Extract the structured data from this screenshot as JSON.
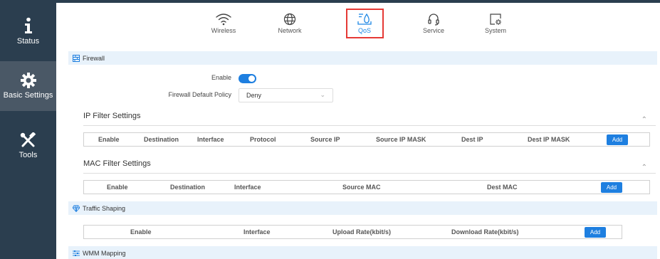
{
  "sidebar": {
    "items": [
      {
        "label": "Status"
      },
      {
        "label": "Basic Settings"
      },
      {
        "label": "Tools"
      }
    ]
  },
  "nav": {
    "items": [
      {
        "label": "Wireless"
      },
      {
        "label": "Network"
      },
      {
        "label": "QoS"
      },
      {
        "label": "Service"
      },
      {
        "label": "System"
      }
    ]
  },
  "firewall": {
    "title": "Firewall",
    "enable_label": "Enable",
    "default_policy_label": "Firewall Default Policy",
    "default_policy_value": "Deny",
    "ip_filter": {
      "title": "IP Filter Settings",
      "columns": [
        "Enable",
        "Destination",
        "Interface",
        "Protocol",
        "Source IP",
        "Source IP MASK",
        "Dest IP",
        "Dest IP MASK"
      ],
      "add_label": "Add"
    },
    "mac_filter": {
      "title": "MAC Filter Settings",
      "columns": [
        "Enable",
        "Destination",
        "Interface",
        "Source MAC",
        "Dest MAC"
      ],
      "add_label": "Add"
    }
  },
  "traffic_shaping": {
    "title": "Traffic Shaping",
    "columns": [
      "Enable",
      "Interface",
      "Upload Rate(kbit/s)",
      "Download Rate(kbit/s)"
    ],
    "add_label": "Add"
  },
  "wmm": {
    "title": "WMM Mapping"
  },
  "colors": {
    "sidebar": "#2b3e4f",
    "accent": "#1e7fe0",
    "highlight": "#e53935"
  }
}
